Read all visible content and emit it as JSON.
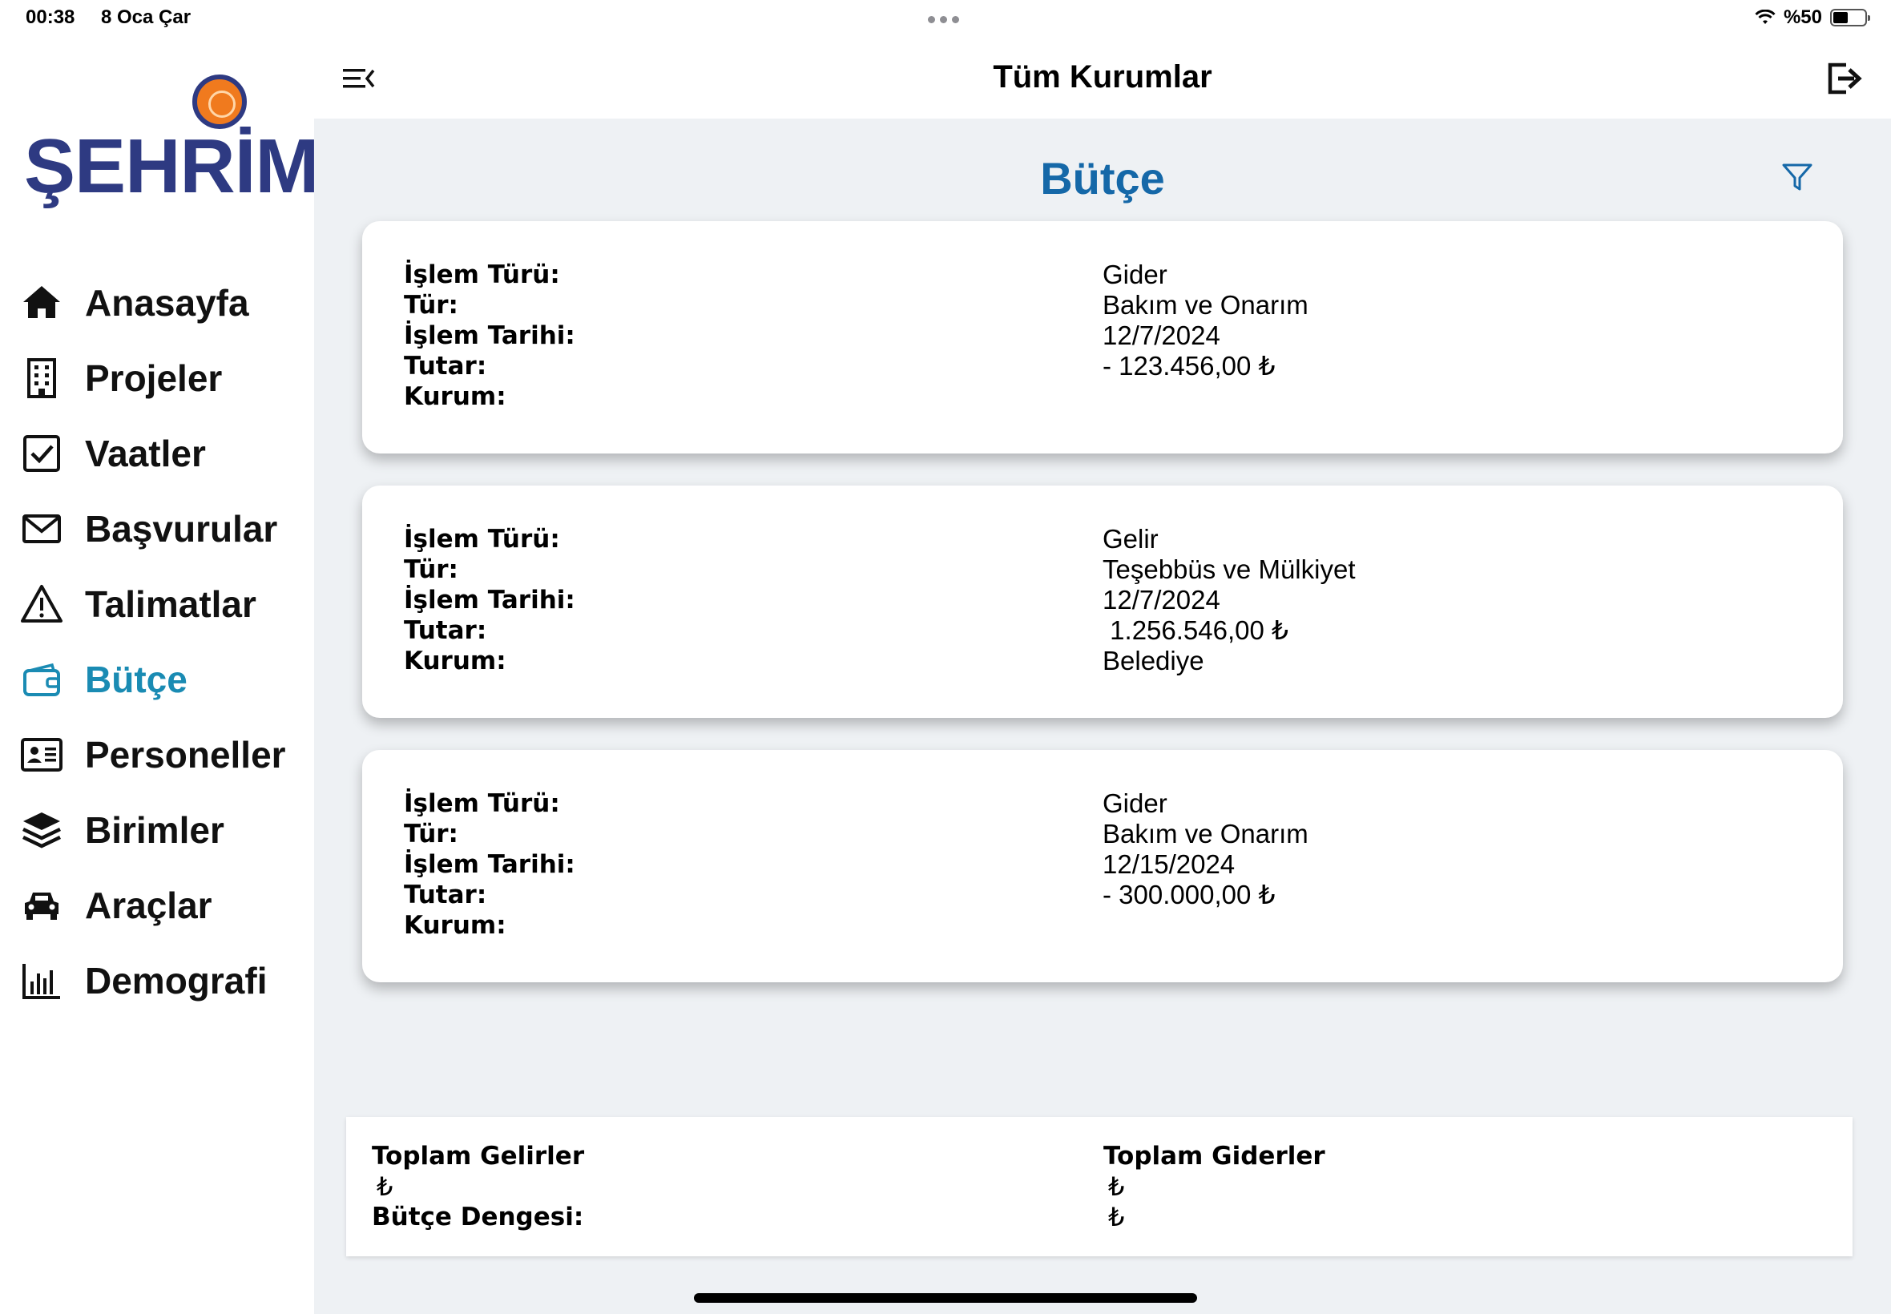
{
  "status_bar": {
    "time": "00:38",
    "date": "8 Oca Çar",
    "battery": "%50"
  },
  "sidebar": {
    "logo_text": "ŞEHRİM",
    "items": [
      {
        "label": "Anasayfa",
        "icon": "home-icon"
      },
      {
        "label": "Projeler",
        "icon": "building-icon"
      },
      {
        "label": "Vaatler",
        "icon": "checkbox-icon"
      },
      {
        "label": "Başvurular",
        "icon": "mail-icon"
      },
      {
        "label": "Talimatlar",
        "icon": "warning-icon"
      },
      {
        "label": "Bütçe",
        "icon": "wallet-icon",
        "active": true
      },
      {
        "label": "Personeller",
        "icon": "id-card-icon"
      },
      {
        "label": "Birimler",
        "icon": "layers-icon"
      },
      {
        "label": "Araçlar",
        "icon": "car-icon"
      },
      {
        "label": "Demografi",
        "icon": "bar-chart-icon"
      }
    ]
  },
  "header": {
    "title": "Tüm Kurumlar"
  },
  "page": {
    "title": "Bütçe"
  },
  "colors": {
    "accent": "#1568a8",
    "active_nav": "#1a8bb3",
    "background": "#eef1f4"
  },
  "record_labels": {
    "islem_turu": "İşlem Türü:",
    "tur": "Tür:",
    "islem_tarihi": "İşlem Tarihi:",
    "tutar": "Tutar:",
    "kurum": "Kurum:"
  },
  "records": [
    {
      "islem_turu": "Gider",
      "tur": "Bakım ve Onarım",
      "islem_tarihi": "12/7/2024",
      "tutar": "- 123.456,00 ₺",
      "kurum": ""
    },
    {
      "islem_turu": "Gelir",
      "tur": "Teşebbüs ve Mülkiyet",
      "islem_tarihi": "12/7/2024",
      "tutar": " 1.256.546,00 ₺",
      "kurum": "Belediye"
    },
    {
      "islem_turu": "Gider",
      "tur": "Bakım ve Onarım",
      "islem_tarihi": "12/15/2024",
      "tutar": "- 300.000,00 ₺",
      "kurum": ""
    }
  ],
  "totals": {
    "gelir_label": "Toplam Gelirler",
    "gelir_value": "₺",
    "denge_label": "Bütçe Dengesi:",
    "gider_label": "Toplam Giderler",
    "gider_value": "₺",
    "denge_value": "₺"
  }
}
